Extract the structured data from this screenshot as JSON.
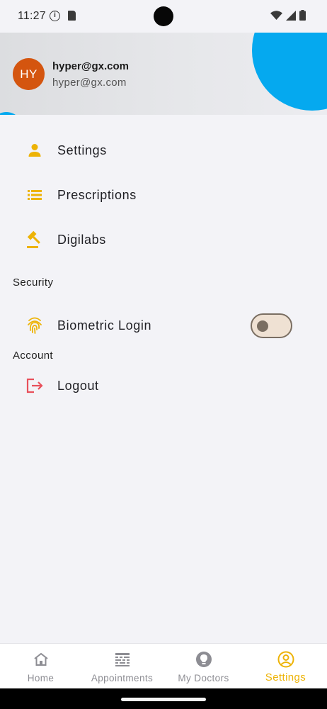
{
  "status_bar": {
    "time": "11:27"
  },
  "header": {
    "avatar_initials": "HY",
    "user_name": "hyper@gx.com",
    "user_email": "hyper@gx.com"
  },
  "menu": {
    "items": [
      {
        "label": "Settings",
        "icon": "person-icon"
      },
      {
        "label": "Prescriptions",
        "icon": "list-icon"
      },
      {
        "label": "Digilabs",
        "icon": "gavel-icon"
      }
    ]
  },
  "security": {
    "title": "Security",
    "biometric_label": "Biometric Login",
    "biometric_enabled": false
  },
  "account": {
    "title": "Account",
    "logout_label": "Logout"
  },
  "bottom_nav": {
    "items": [
      {
        "label": "Home",
        "icon": "home-icon",
        "active": false
      },
      {
        "label": "Appointments",
        "icon": "appointments-icon",
        "active": false
      },
      {
        "label": "My Doctors",
        "icon": "lightbulb-icon",
        "active": false
      },
      {
        "label": "Settings",
        "icon": "account-circle-icon",
        "active": true
      }
    ]
  },
  "colors": {
    "accent": "#edb306",
    "header_blob": "#05a9ef",
    "avatar": "#d4550f",
    "logout_icon": "#e8505b",
    "inactive_nav": "#8d8d93"
  }
}
